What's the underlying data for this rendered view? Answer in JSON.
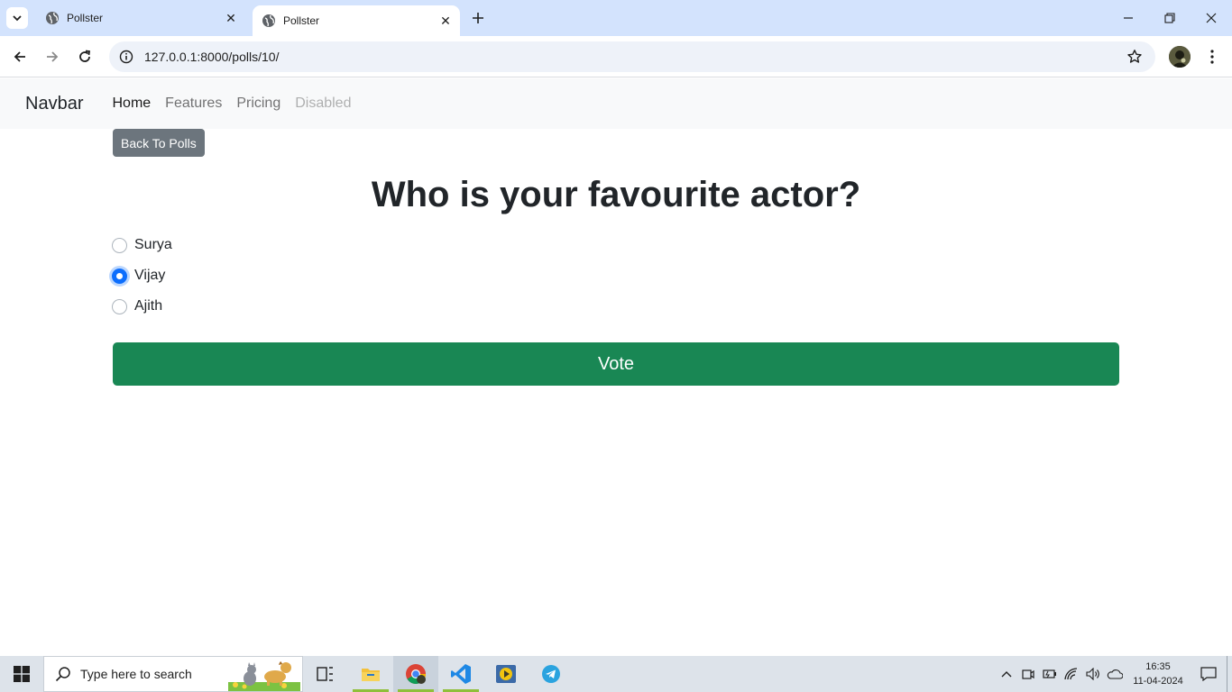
{
  "browser": {
    "tabs": [
      {
        "title": "Pollster",
        "active": false
      },
      {
        "title": "Pollster",
        "active": true
      }
    ],
    "url": "127.0.0.1:8000/polls/10/"
  },
  "navbar": {
    "brand": "Navbar",
    "links": [
      {
        "label": "Home",
        "state": "active"
      },
      {
        "label": "Features",
        "state": "normal"
      },
      {
        "label": "Pricing",
        "state": "normal"
      },
      {
        "label": "Disabled",
        "state": "disabled"
      }
    ]
  },
  "page": {
    "back_label": "Back To Polls",
    "question": "Who is your favourite actor?",
    "choices": [
      {
        "label": "Surya",
        "checked": false
      },
      {
        "label": "Vijay",
        "checked": true
      },
      {
        "label": "Ajith",
        "checked": false
      }
    ],
    "vote_label": "Vote"
  },
  "taskbar": {
    "search_placeholder": "Type here to search",
    "time": "16:35",
    "date": "11-04-2024"
  },
  "colors": {
    "vote_button": "#198754",
    "back_button": "#6c757d",
    "radio_checked": "#0d6efd",
    "tabstrip": "#d3e3fd"
  }
}
